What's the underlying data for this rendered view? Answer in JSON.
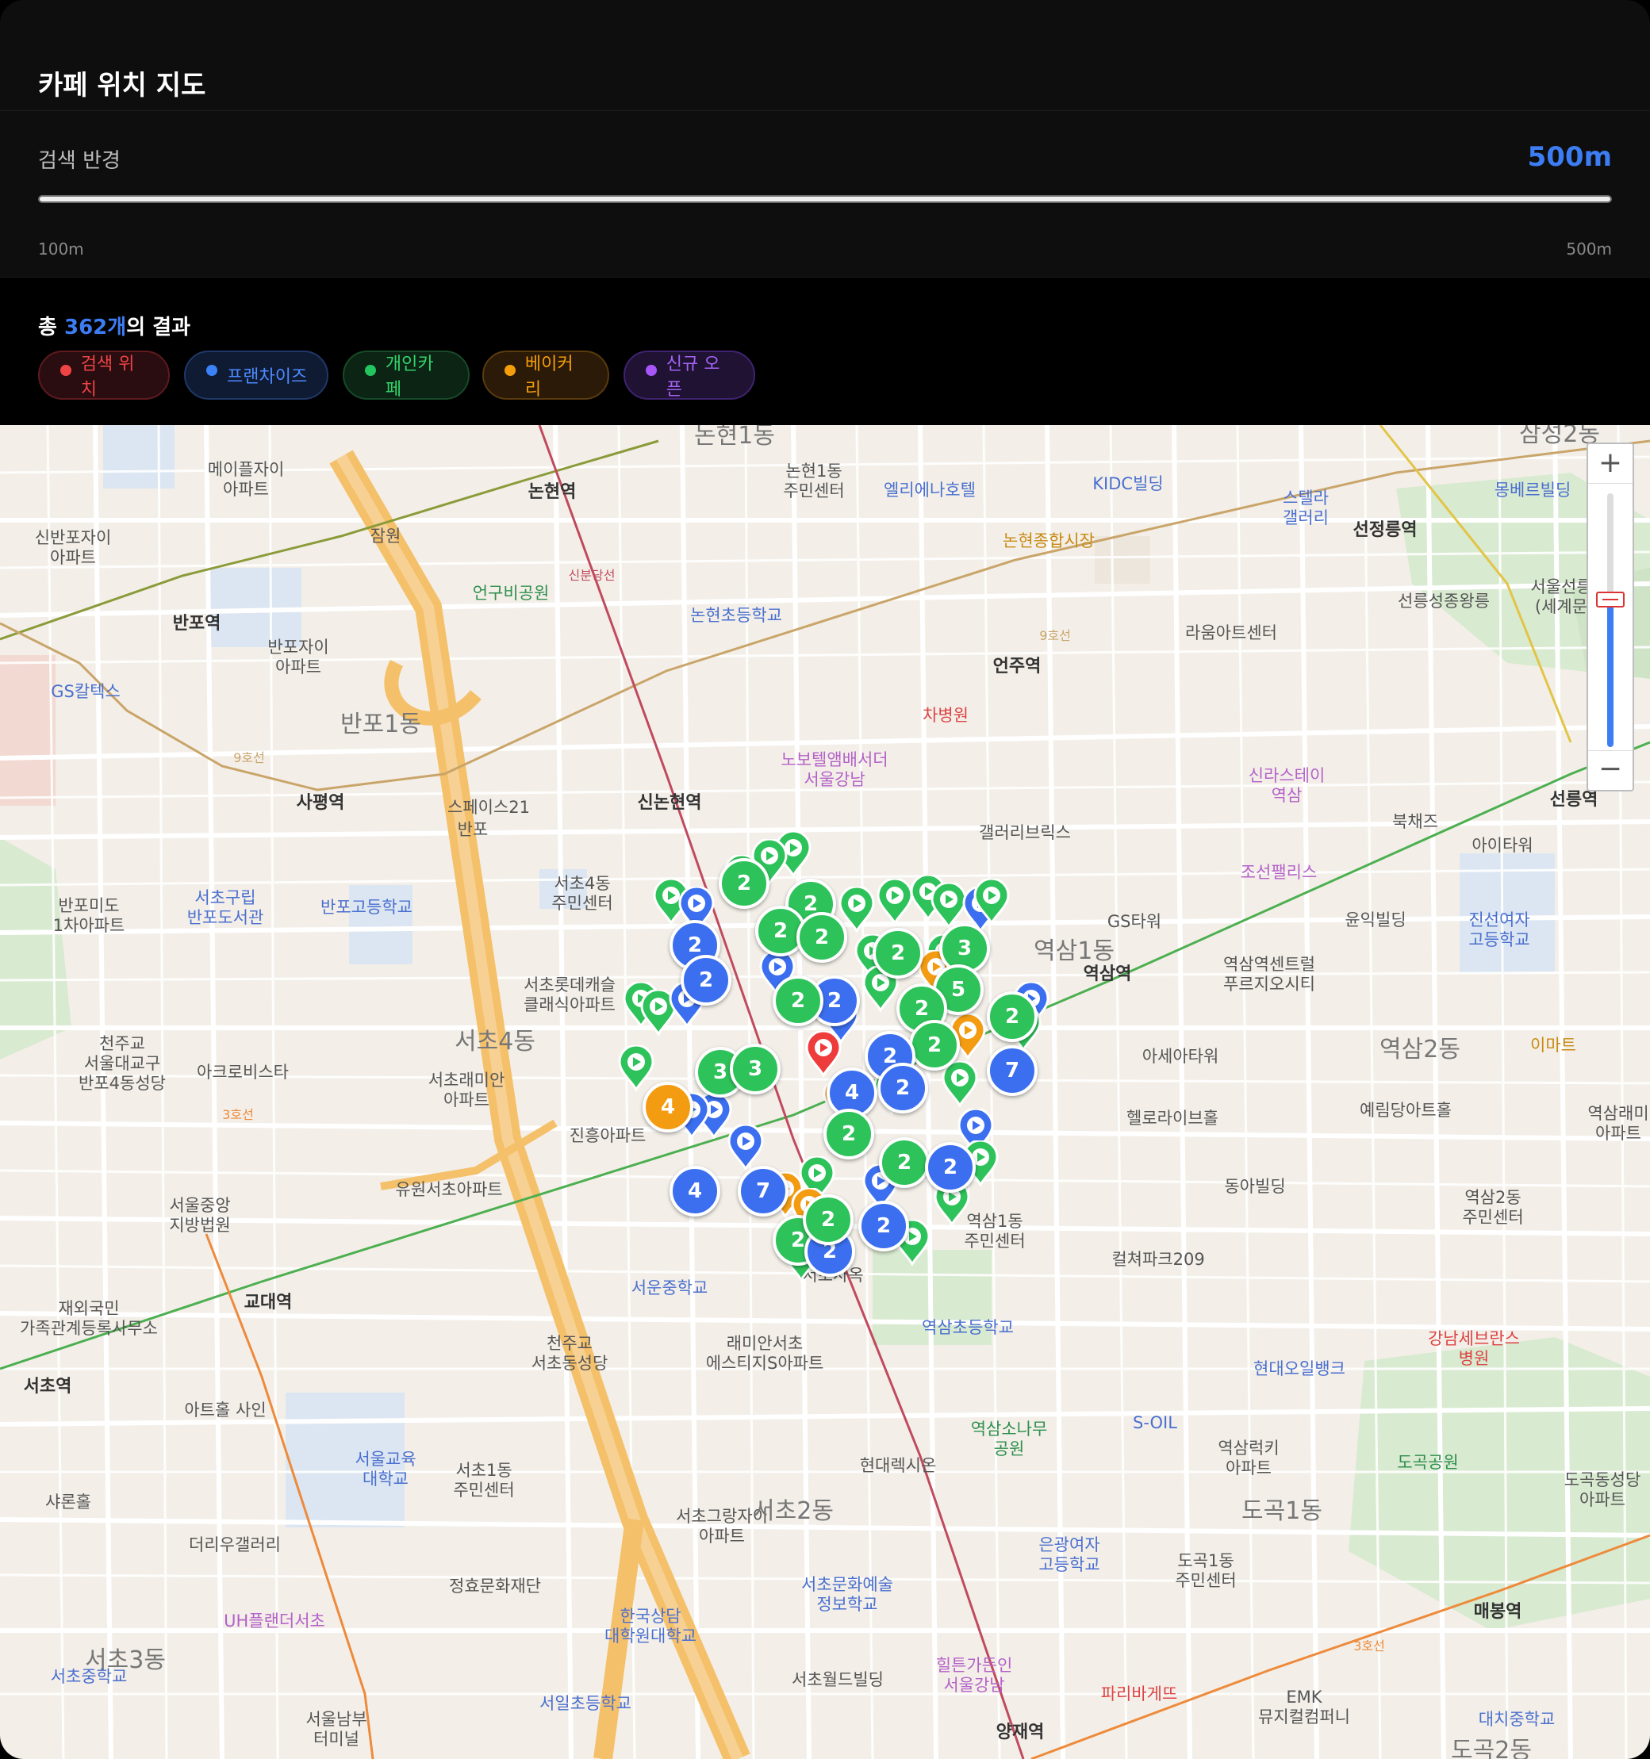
{
  "header": {
    "title": "카페 위치 지도"
  },
  "radius": {
    "label": "검색 반경",
    "value": "500m",
    "min_label": "100m",
    "max_label": "500m",
    "level": 1.0
  },
  "results": {
    "prefix": "총 ",
    "count": "362개",
    "suffix": "의 결과"
  },
  "legend": [
    {
      "label": "검색 위치",
      "color": "#ef4444"
    },
    {
      "label": "프랜차이즈",
      "color": "#3b82f6"
    },
    {
      "label": "개인카페",
      "color": "#22c55e"
    },
    {
      "label": "베이커리",
      "color": "#f59e0b"
    },
    {
      "label": "신규 오픈",
      "color": "#a855f7"
    }
  ],
  "map": {
    "zoom": {
      "in_label": "+",
      "out_label": "−"
    },
    "labels": {
      "nonhyeon1dong": "논현1동",
      "nonhyeon_station": "논현역",
      "mapleXi": "메이플자이\n아파트",
      "shinbanpo": "신반포자이\n아파트",
      "jamwon": "잠원",
      "nonhyeon_center": "논현1동\n주민센터",
      "ellena": "엘리에나호텔",
      "kidc": "KIDC빌딩",
      "stella": "스텔라\n갤러리",
      "seonjeongneung": "선정릉역",
      "nonhyeon_market": "논현종합시장",
      "eongubi": "언구비공원",
      "nonhyeon_school": "논현초등학교",
      "banpo_station": "반포역",
      "banpoXi": "반포자이\n아파트",
      "gs_caltex": "GS칼텍스",
      "banpo1dong": "반포1동",
      "sapyeong": "사평역",
      "space21": "스페이스21",
      "banpo_ic": "반포",
      "sinnonhyeon": "신논현역",
      "novotel": "노보텔앰배서더\n서울강남",
      "chabyeongwon": "차병원",
      "eonju": "언주역",
      "raum": "라움아트센터",
      "seolleung_royal": "선릉성종왕릉",
      "seoul_seollyeong": "서울선릉\n(세계문",
      "shilla_stay": "신라스테이\n역삼",
      "gallery_brix": "갤러리브릭스",
      "bukchaejeu": "북채즈",
      "seolleung_station": "선릉역",
      "itower": "아이타워",
      "banpo_mido": "반포미도\n1차아파트",
      "seocho_library": "서초구립\n반포도서관",
      "banpo_high": "반포고등학교",
      "seocho4_center": "서초4동\n주민센터",
      "chosun_palace": "조선팰리스",
      "gs_tower": "GS타워",
      "yuneik": "윤익빌딩",
      "jinsun": "진선여자\n고등학교",
      "yeoksam1dong": "역삼1동",
      "yeoksam_station": "역삼역",
      "yeoksam_centreville": "역삼역센트럴\n푸르지오시티",
      "lotte_classic": "서초롯데캐슬\n클래식아파트",
      "cheonjugyo": "천주교\n서울대교구\n반포4동성당",
      "acro_vista": "아크로비스타",
      "seocho4dong": "서초4동",
      "seocho_raemian": "서초래미안\n아파트",
      "asia_tower": "아세아타워",
      "yeoksam2dong": "역삼2동",
      "emart": "이마트",
      "jinheung": "진흥아파트",
      "herald": "헬로라이브홀",
      "yeraedang": "예림당아트홀",
      "yeoksam_raemian": "역삼래미\n아파트",
      "yuwon": "유원서초아파트",
      "central_court": "서울중앙\n지방법원",
      "dongah": "동아빌딩",
      "yeoksam2_center": "역삼2동\n주민센터",
      "yeoksam1_center": "역삼1동\n주민센터",
      "culture_park": "컬쳐파크209",
      "overseas": "재외국민\n가족관계등록사무소",
      "gyodae": "교대역",
      "seocho_station": "서초역",
      "seoun_middle": "서운중학교",
      "seocho_samu": "서초사옥",
      "yeoksam_elem": "역삼초등학교",
      "cheonju_seocho": "천주교\n서초동성당",
      "raemian_estige": "래미안서초\n에스티지S아파트",
      "hyundai_oil": "현대오일뱅크",
      "gangnam_severance": "강남세브란스\n병원",
      "arthall": "아트홀 사인",
      "seoul_edu": "서울교육\n대학교",
      "seocho1_center": "서초1동\n주민센터",
      "hyundai_richsium": "현대렉시온",
      "yeoksam_sonamu": "역삼소나무\n공원",
      "s_oil": "S-OIL",
      "yeoksam_lucky": "역삼럭키\n아파트",
      "dogok_park": "도곡공원",
      "sharon": "샤론홀",
      "the_liu": "더리우갤러리",
      "seocho_grand": "서초그랑자이\n아파트",
      "seocho2dong": "서초2동",
      "dogok1dong": "도곡1동",
      "eungwang": "은광여자\n고등학교",
      "dogok1_center": "도곡1동\n주민센터",
      "dogok_church": "도곡동성당\n아파트",
      "maebong": "매봉역",
      "jeonghyo": "정효문화재단",
      "seocho_art": "서초문화예술\n정보학교",
      "uh_plan": "UH플랜더서초",
      "hanguk": "한국상담\n대학원대학교",
      "hilton": "힐튼가든인\n서울강남",
      "paris": "파리바게뜨",
      "seocho3dong": "서초3동",
      "seocho_middle": "서초중학교",
      "seoul_nambu": "서울남부\n터미널",
      "seoil": "서일초등학교",
      "seocho_world": "서초월드빌딩",
      "yangjae": "양재역",
      "emk": "EMK\n뮤지컬컴퍼니",
      "daechi_middle": "대치중학교",
      "dogok2dong": "도곡2동",
      "samseong2dong": "삼성2동",
      "mombel": "몽베르빌딩",
      "line9": "9호선",
      "line3": "3호선",
      "sinbundang": "신분당선"
    }
  },
  "markers": {
    "search_center": {
      "type": "search",
      "lat_rel": "center"
    },
    "clusters": [
      {
        "count": "2",
        "kind": "green"
      },
      {
        "count": "2",
        "kind": "green"
      },
      {
        "count": "2",
        "kind": "green"
      },
      {
        "count": "2",
        "kind": "green"
      },
      {
        "count": "2",
        "kind": "blue"
      },
      {
        "count": "2",
        "kind": "green"
      },
      {
        "count": "3",
        "kind": "green"
      },
      {
        "count": "2",
        "kind": "blue"
      },
      {
        "count": "5",
        "kind": "green"
      },
      {
        "count": "2",
        "kind": "green"
      },
      {
        "count": "2",
        "kind": "green"
      },
      {
        "count": "2",
        "kind": "green"
      },
      {
        "count": "2",
        "kind": "blue"
      },
      {
        "count": "2",
        "kind": "blue"
      },
      {
        "count": "2",
        "kind": "green"
      },
      {
        "count": "3",
        "kind": "green"
      },
      {
        "count": "3",
        "kind": "green"
      },
      {
        "count": "2",
        "kind": "blue"
      },
      {
        "count": "7",
        "kind": "blue"
      },
      {
        "count": "4",
        "kind": "orange"
      },
      {
        "count": "4",
        "kind": "blue"
      },
      {
        "count": "2",
        "kind": "green"
      },
      {
        "count": "2",
        "kind": "green"
      },
      {
        "count": "2",
        "kind": "blue"
      },
      {
        "count": "4",
        "kind": "blue"
      },
      {
        "count": "7",
        "kind": "blue"
      },
      {
        "count": "2",
        "kind": "green"
      },
      {
        "count": "2",
        "kind": "blue"
      },
      {
        "count": "2",
        "kind": "blue"
      },
      {
        "count": "2",
        "kind": "green"
      }
    ]
  }
}
